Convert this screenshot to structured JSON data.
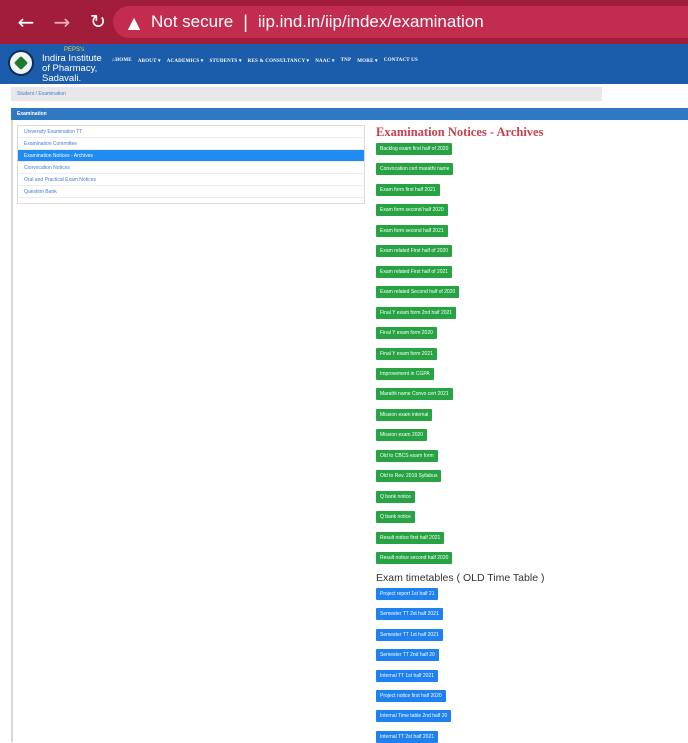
{
  "browser": {
    "back_icon": "arrow-left-icon",
    "forward_icon": "arrow-right-icon",
    "reload_icon": "reload-icon",
    "warning_icon": "warning-triangle-icon",
    "security_label": "Not secure",
    "separator": "|",
    "url": "iip.ind.in/iip/index/examination"
  },
  "header": {
    "brand_small": "PEPS's",
    "brand_line1": "Indira Institute",
    "brand_line2": "of Pharmacy,",
    "brand_line3": "Sadavali.",
    "menu": [
      "⌂HOME",
      "ABOUT ▾",
      "ACADEMICS ▾",
      "STUDENTS ▾",
      "RES & CONSULTANCY ▾",
      "NAAC ▾",
      "TNP",
      "MORE ▾",
      "CONTACT US"
    ]
  },
  "breadcrumb": "Student / Examination",
  "section_title": "Examination",
  "sidebar": {
    "items": [
      "University Examination TT",
      "Examination Committee",
      "Examination Notices - Archives",
      "Convocation Notices",
      "Oral and Practical Exam Notices",
      "Question Bank"
    ],
    "active_index": 2
  },
  "main": {
    "heading": "Examination Notices - Archives",
    "archive_buttons": [
      "Backlog exam first half of 2020",
      "Convocation cert marathi name",
      "Exam form first half 2021",
      "Exam form second half 2020",
      "Exam form second half 2021",
      "Exam related First half of 2020",
      "Exam related First half of 2021",
      "Exam related Second half of 2020",
      "Final Y exam form 2nd half 2021",
      "Final Y exam form 2020",
      "Final Y exam form 2021",
      "Improvement in CGPA",
      "Marathi name Convo cert 2021",
      "Mission exam internal",
      "Mission exam 2020",
      "Old to CBCS exam form",
      "Old to Rev. 2019 Syllabus",
      "Q bank notice",
      "Q bank notice",
      "Result notice first half 2021",
      "Result notice second half 2020"
    ],
    "timetable_heading": "Exam timetables ( OLD Time Table )",
    "timetable_buttons": [
      "Project report 1st half 21",
      "Semester TT 2st half 2021",
      "Semester TT 1st half 2021",
      "Semester TT 2nd half 20",
      "Internal TT 1st half 2021",
      "Project notice first half 2020",
      "Internal Time table 2nd half 20",
      "Internal TT 2st half 2021"
    ]
  },
  "colors": {
    "browser_bar": "#a21d3a",
    "header": "#1b5cab",
    "archive_button": "#27a344",
    "timetable_button": "#1f80f0",
    "heading": "#c8414e"
  }
}
